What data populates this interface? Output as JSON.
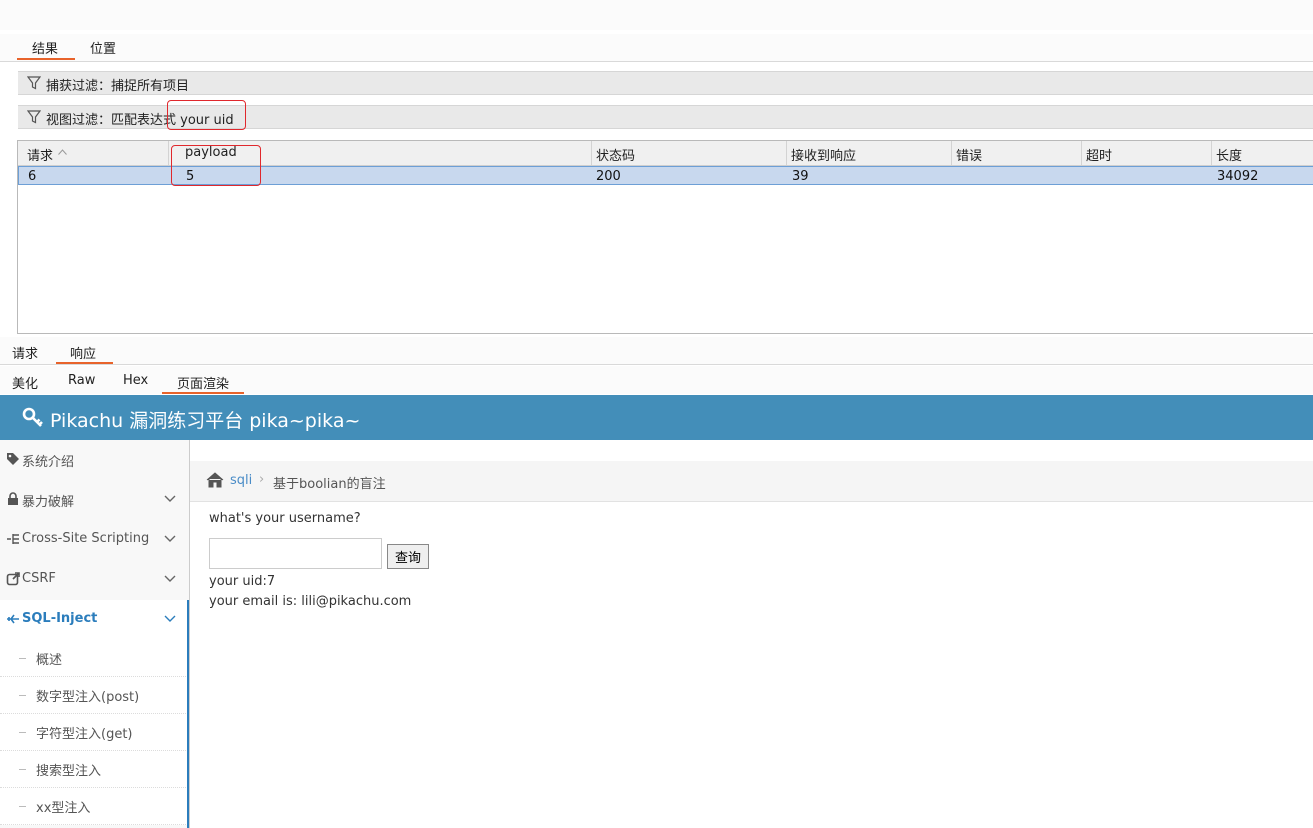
{
  "top_tabs": {
    "results": "结果",
    "positions": "位置"
  },
  "filters": {
    "capture": "捕获过滤：捕捉所有项目",
    "view": "视图过滤：匹配表达式 your uid"
  },
  "table": {
    "columns": [
      "请求",
      "payload",
      "状态码",
      "接收到响应",
      "错误",
      "超时",
      "长度"
    ],
    "rows": [
      [
        "6",
        "5",
        "200",
        "39",
        "",
        "",
        "34092"
      ]
    ]
  },
  "bottom_tabs": {
    "request": "请求",
    "response": "响应"
  },
  "view_tabs": {
    "pretty": "美化",
    "raw": "Raw",
    "hex": "Hex",
    "render": "页面渲染"
  },
  "pikachu": {
    "title": "Pikachu 漏洞练习平台 pika~pika~",
    "sidebar": [
      {
        "label": "系统介绍",
        "icon": "tag-icon"
      },
      {
        "label": "暴力破解",
        "icon": "lock-icon"
      },
      {
        "label": "Cross-Site Scripting",
        "icon": "list-icon"
      },
      {
        "label": "CSRF",
        "icon": "external-link-icon"
      },
      {
        "label": "SQL-Inject",
        "icon": "plane-icon"
      }
    ],
    "submenu": [
      "概述",
      "数字型注入(post)",
      "字符型注入(get)",
      "搜索型注入",
      "xx型注入"
    ],
    "breadcrumb": {
      "root": "sqli",
      "current": "基于boolian的盲注"
    },
    "question": "what's your username?",
    "input_value": "",
    "query_button": "查询",
    "result_uid": "your uid:7",
    "result_email": "your email is: lili@pikachu.com"
  },
  "colors": {
    "accent": "#e8632b",
    "banner": "#438eb9",
    "highlight_row": "#c8d8ee",
    "annotation": "#e0282d",
    "link": "#4a8cc7"
  }
}
